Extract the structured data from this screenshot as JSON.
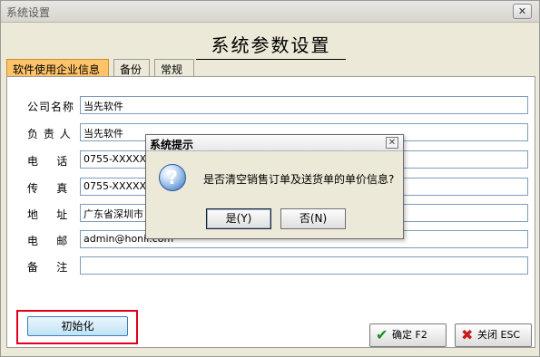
{
  "window": {
    "title": "系统设置"
  },
  "heading": "系统参数设置",
  "tabs": [
    {
      "label": "软件使用企业信息",
      "active": true
    },
    {
      "label": "备份",
      "active": false
    },
    {
      "label": "常规",
      "active": false
    }
  ],
  "fields": [
    {
      "label": "公司名称",
      "value": "当先软件"
    },
    {
      "label": "负 责 人",
      "value": "当先软件"
    },
    {
      "label": "电    话",
      "value": "0755-XXXXXXX"
    },
    {
      "label": "传    真",
      "value": "0755-XXXXXXX"
    },
    {
      "label": "地    址",
      "value": "广东省深圳市"
    },
    {
      "label": "电    邮",
      "value": "admin@honii.com"
    },
    {
      "label": "备    注",
      "value": ""
    }
  ],
  "buttons": {
    "init": "初始化",
    "ok": "确定 F2",
    "close": "关闭 ESC"
  },
  "dialog": {
    "title": "系统提示",
    "message": "是否清空销售订单及送货单的单价信息?",
    "yes": "是(Y)",
    "no": "否(N)"
  },
  "colors": {
    "active_tab": "#ffc46a",
    "highlight_border": "#e0001b",
    "init_button": "#bfe3f6"
  },
  "icons": {
    "dialog": "question-icon",
    "ok": "check-icon",
    "close": "x-icon"
  }
}
